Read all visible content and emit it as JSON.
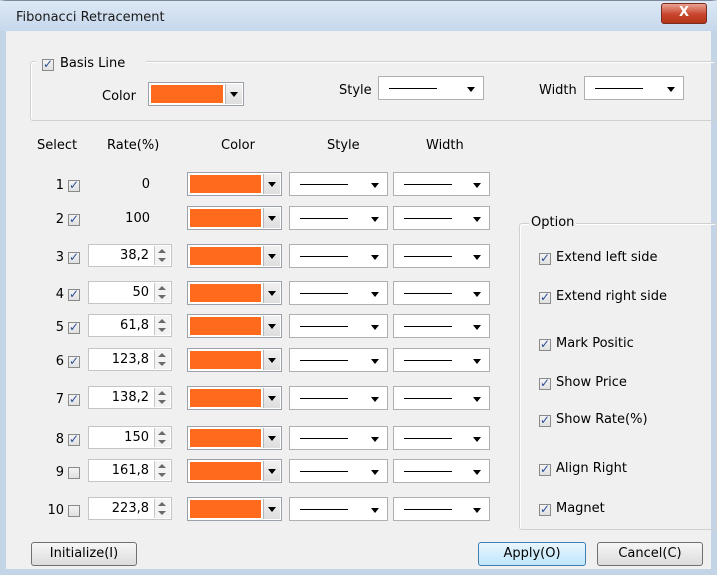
{
  "window": {
    "title": "Fibonacci Retracement",
    "close_label": "X"
  },
  "basis": {
    "label": "Basis Line",
    "checked": true,
    "color_label": "Color",
    "style_label": "Style",
    "width_label": "Width",
    "color": "#ff6a1d"
  },
  "table": {
    "headers": {
      "select": "Select",
      "rate": "Rate(%)",
      "color": "Color",
      "style": "Style",
      "width": "Width"
    },
    "rows": [
      {
        "index": "1",
        "checked": true,
        "rate": "0",
        "editable": false
      },
      {
        "index": "2",
        "checked": true,
        "rate": "100",
        "editable": false
      },
      {
        "index": "3",
        "checked": true,
        "rate": "38,2",
        "editable": true
      },
      {
        "index": "4",
        "checked": true,
        "rate": "50",
        "editable": true
      },
      {
        "index": "5",
        "checked": true,
        "rate": "61,8",
        "editable": true
      },
      {
        "index": "6",
        "checked": true,
        "rate": "123,8",
        "editable": true
      },
      {
        "index": "7",
        "checked": true,
        "rate": "138,2",
        "editable": true
      },
      {
        "index": "8",
        "checked": true,
        "rate": "150",
        "editable": true
      },
      {
        "index": "9",
        "checked": false,
        "rate": "161,8",
        "editable": true
      },
      {
        "index": "10",
        "checked": false,
        "rate": "223,8",
        "editable": true
      }
    ]
  },
  "option": {
    "title": "Option",
    "items": [
      {
        "label": "Extend left side",
        "checked": true
      },
      {
        "label": "Extend right side",
        "checked": true
      },
      {
        "label": "Mark Positic",
        "checked": true
      },
      {
        "label": "Show Price",
        "checked": true
      },
      {
        "label": "Show Rate(%)",
        "checked": true
      },
      {
        "label": "Align Right",
        "checked": true
      },
      {
        "label": "Magnet",
        "checked": true
      }
    ]
  },
  "buttons": {
    "initialize": "Initialize(I)",
    "apply": "Apply(O)",
    "cancel": "Cancel(C)"
  }
}
